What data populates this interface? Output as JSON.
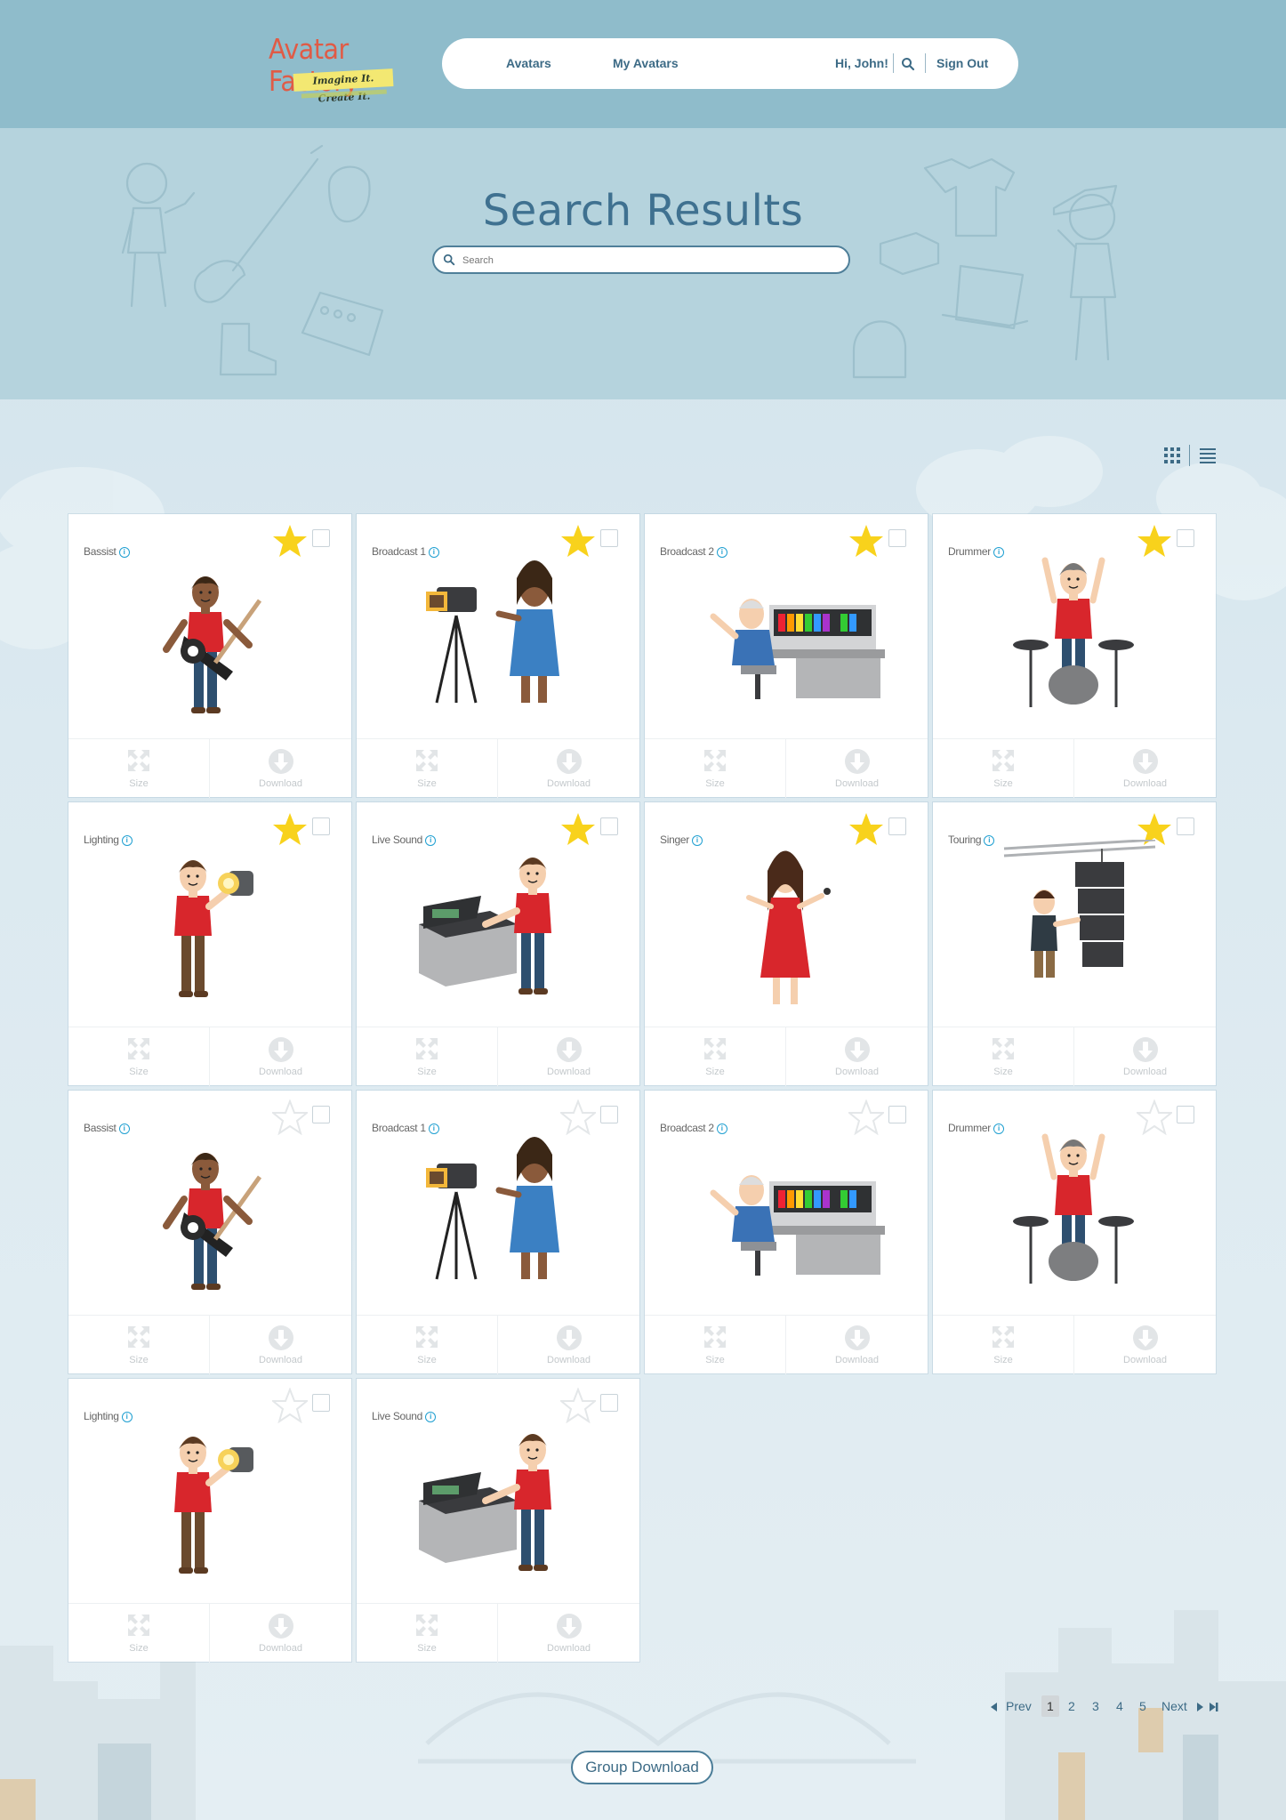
{
  "header": {
    "logo_title": "Avatar Factory",
    "logo_tagline": "Imagine It. Create It.",
    "nav_avatars": "Avatars",
    "nav_my_avatars": "My Avatars",
    "greeting": "Hi, John!",
    "sign_out": "Sign Out"
  },
  "hero": {
    "title": "Search Results",
    "search_placeholder": "Search"
  },
  "view_toggle": {
    "grid_icon": "grid-icon",
    "list_icon": "list-icon"
  },
  "card_actions": {
    "size_label": "Size",
    "download_label": "Download"
  },
  "cards": [
    {
      "label": "Bassist",
      "art": "bassist",
      "favorited": true
    },
    {
      "label": "Broadcast 1",
      "art": "broadcast1",
      "favorited": true
    },
    {
      "label": "Broadcast 2",
      "art": "broadcast2",
      "favorited": true
    },
    {
      "label": "Drummer",
      "art": "drummer",
      "favorited": true
    },
    {
      "label": "Lighting",
      "art": "lighting",
      "favorited": true
    },
    {
      "label": "Live Sound",
      "art": "livesound",
      "favorited": true
    },
    {
      "label": "Singer",
      "art": "singer",
      "favorited": true
    },
    {
      "label": "Touring",
      "art": "touring",
      "favorited": true
    },
    {
      "label": "Bassist",
      "art": "bassist",
      "favorited": false
    },
    {
      "label": "Broadcast 1",
      "art": "broadcast1",
      "favorited": false
    },
    {
      "label": "Broadcast 2",
      "art": "broadcast2",
      "favorited": false
    },
    {
      "label": "Drummer",
      "art": "drummer",
      "favorited": false
    },
    {
      "label": "Lighting",
      "art": "lighting",
      "favorited": false
    },
    {
      "label": "Live Sound",
      "art": "livesound",
      "favorited": false
    }
  ],
  "pagination": {
    "prev": "Prev",
    "pages": [
      "1",
      "2",
      "3",
      "4",
      "5"
    ],
    "current": "1",
    "next": "Next"
  },
  "group_download": "Group Download",
  "colors": {
    "header_bg": "#8fbccb",
    "hero_bg": "#b5d3dd",
    "accent": "#3d6b86",
    "star_active": "#f8d21c",
    "logo_red": "#e05b46"
  }
}
